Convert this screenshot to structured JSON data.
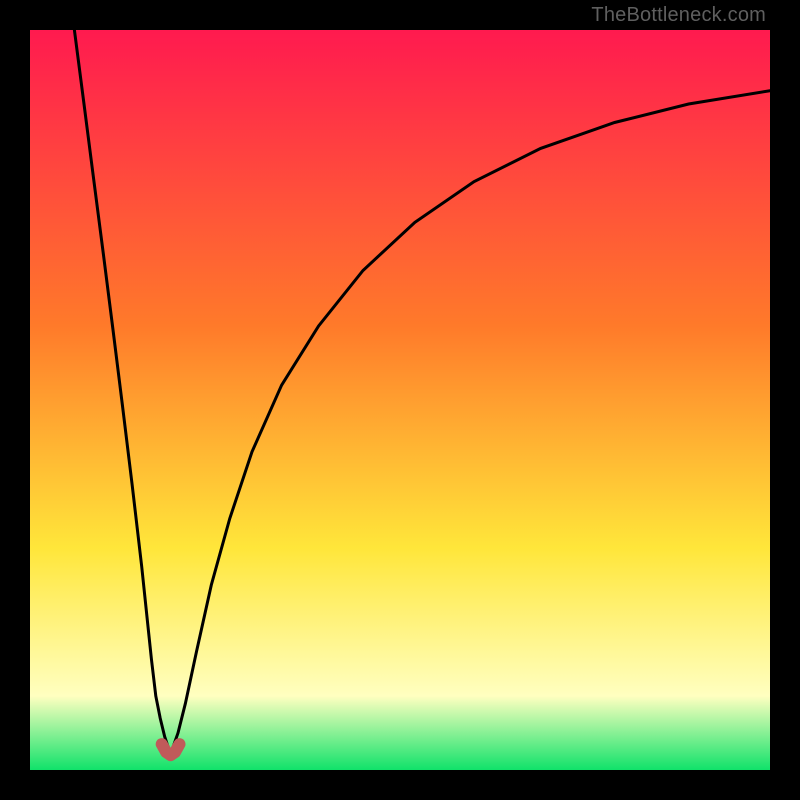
{
  "watermark": "TheBottleneck.com",
  "colors": {
    "frame": "#000000",
    "curve": "#000000",
    "marker": "#c05a5a",
    "grad_top": "#ff1a4f",
    "grad_mid1": "#ff7a2a",
    "grad_mid2": "#ffe63a",
    "grad_pale": "#ffffc0",
    "grad_bottom": "#10e26a"
  },
  "chart_data": {
    "type": "line",
    "title": "",
    "xlabel": "",
    "ylabel": "",
    "xlim": [
      0,
      100
    ],
    "ylim": [
      0,
      100
    ],
    "notch_x": 19,
    "series": [
      {
        "name": "left-branch",
        "x": [
          6.0,
          7.3,
          8.6,
          9.9,
          11.2,
          12.5,
          13.8,
          15.1,
          16.4,
          17.0,
          17.6,
          18.2,
          18.7
        ],
        "y": [
          100,
          90.0,
          79.9,
          69.8,
          59.6,
          49.2,
          38.6,
          27.5,
          15.0,
          10.0,
          7.0,
          4.5,
          3.0
        ]
      },
      {
        "name": "right-branch",
        "x": [
          19.3,
          20.0,
          21.0,
          22.5,
          24.5,
          27.0,
          30.0,
          34.0,
          39.0,
          45.0,
          52.0,
          60.0,
          69.0,
          79.0,
          89.0,
          100.0
        ],
        "y": [
          3.0,
          5.0,
          9.0,
          16.0,
          25.0,
          34.0,
          43.0,
          52.0,
          60.0,
          67.5,
          74.0,
          79.5,
          84.0,
          87.5,
          90.0,
          91.8
        ]
      }
    ],
    "marker": {
      "name": "min-point",
      "points_x": [
        17.8,
        18.4,
        19.0,
        19.6,
        20.2
      ],
      "points_y": [
        3.5,
        2.4,
        2.0,
        2.4,
        3.5
      ]
    }
  }
}
